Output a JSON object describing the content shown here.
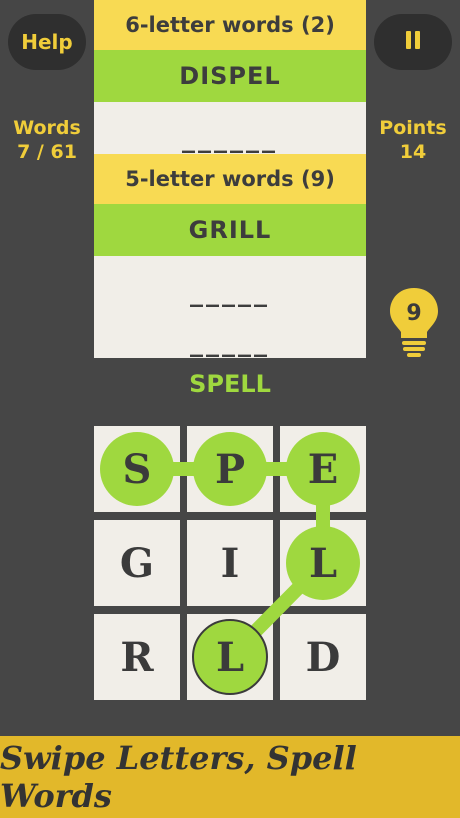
{
  "help_label": "Help",
  "stats": {
    "words_label": "Words",
    "words_value": "7 / 61",
    "points_label": "Points",
    "points_value": "14"
  },
  "word_list": {
    "six_header": "6-letter words (2)",
    "six_found": "DISPEL",
    "six_blank": "______",
    "five_header": "5-letter words (9)",
    "five_found": "GRILL",
    "five_blank_1": "_____",
    "five_blank_2": "_____"
  },
  "current_word": "SPELL",
  "hint_count": "9",
  "grid": {
    "letters": [
      "S",
      "P",
      "E",
      "G",
      "I",
      "L",
      "R",
      "L",
      "D"
    ],
    "selected_path": [
      0,
      1,
      2,
      5,
      7
    ]
  },
  "banner_text": "Swipe Letters, Spell Words",
  "colors": {
    "background": "#464646",
    "accent_yellow": "#f0cd3a",
    "accent_green": "#9fd83f",
    "panel": "#f1eee8"
  }
}
